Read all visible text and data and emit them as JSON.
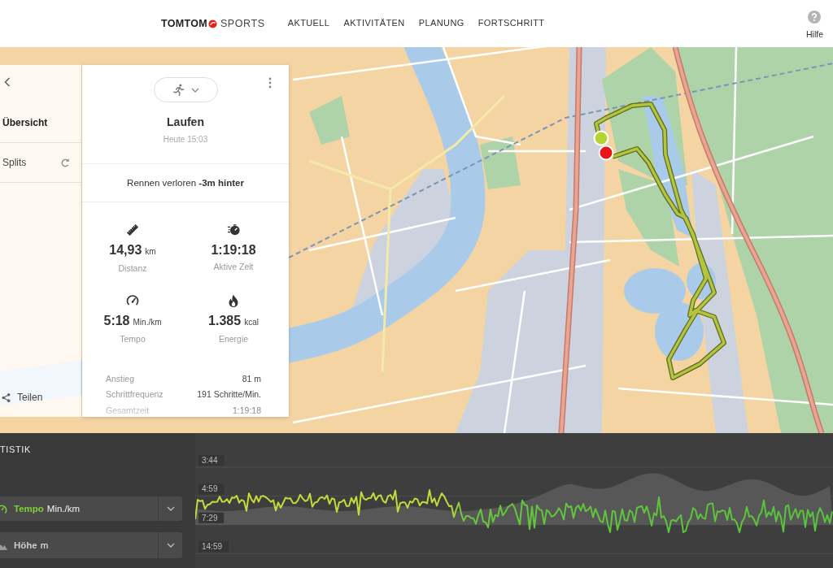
{
  "header": {
    "logo": {
      "brand": "TOMTOM",
      "product": "SPORTS"
    },
    "nav": [
      {
        "label": "AKTUELL",
        "selected": false
      },
      {
        "label": "AKTIVITÄTEN",
        "selected": false
      },
      {
        "label": "PLANUNG",
        "selected": false
      },
      {
        "label": "FORTSCHRITT",
        "selected": false
      }
    ],
    "help": {
      "label": "Hilfe"
    }
  },
  "side_panel": {
    "items": [
      {
        "label": "Übersicht",
        "selected": true,
        "kind": "plain"
      },
      {
        "label": "Splits",
        "selected": false,
        "kind": "loop"
      }
    ],
    "share": {
      "label": "Teilen"
    }
  },
  "activity": {
    "title": "Laufen",
    "date": "Heute 15:03",
    "race": "Rennen verloren **-3m hinter**",
    "stats": [
      {
        "kind": "distance",
        "value": "14,93",
        "unit": "km",
        "label": "Distanz"
      },
      {
        "kind": "time",
        "value": "1:19:18",
        "label": "Aktive Zeit"
      },
      {
        "kind": "pace",
        "value": "5:18",
        "unit": "Min./km",
        "label": "Tempo"
      },
      {
        "kind": "energy",
        "value": "1.385",
        "unit": "kcal",
        "label": "Energie"
      }
    ],
    "details": [
      {
        "label": "Anstieg",
        "value": "81 m"
      },
      {
        "label": "Schrittfrequenz",
        "value": "191 Schritte/Min."
      },
      {
        "label": "Gesamtzeit",
        "value": "1:19:18"
      }
    ]
  },
  "statistics": {
    "title": "TISTIK",
    "metrics": [
      {
        "kind": "pace",
        "name": "Tempo",
        "unit": "Min./km",
        "selected": true
      },
      {
        "kind": "elevation",
        "name": "Höhe",
        "unit": "m",
        "selected": false
      }
    ],
    "axis_labels": [
      "3:44",
      "4:59",
      "7:29",
      "14:59"
    ]
  }
}
